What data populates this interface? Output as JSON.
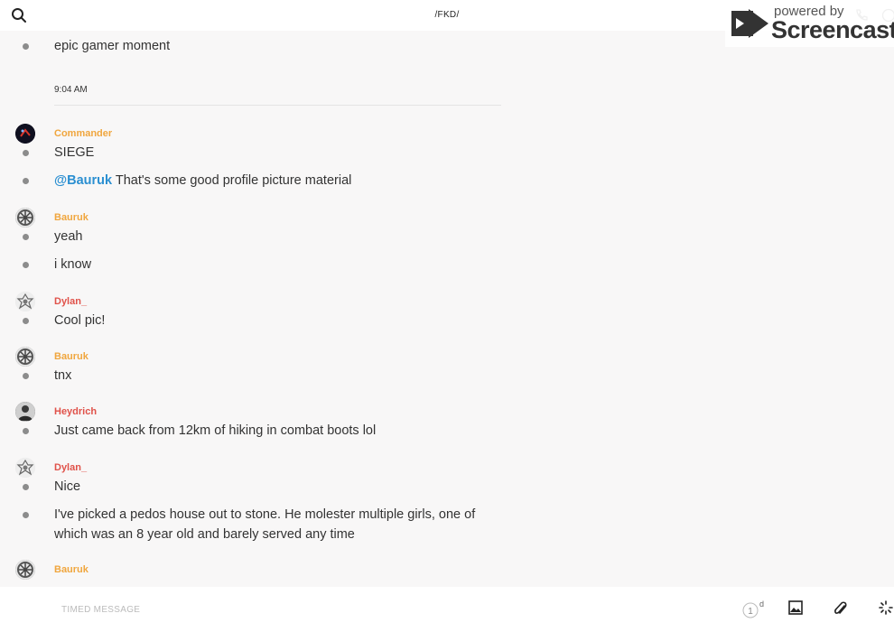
{
  "header": {
    "title": "/FKD/",
    "search_icon": "search-icon",
    "call_icon": "phone-icon",
    "info_icon": "info-icon"
  },
  "watermark": {
    "powered": "powered by",
    "brand": "Screencastify"
  },
  "messages": {
    "m0": "epic gamer moment",
    "timestamp": "9:04 AM",
    "g1_user": "Commander",
    "m1": "SIEGE",
    "m2_mention": "@Bauruk",
    "m2_text": " That's some good profile picture material",
    "g2_user": "Bauruk",
    "m3": "yeah",
    "m4": "i know",
    "g3_user": "Dylan_",
    "m5": "Cool pic!",
    "g4_user": "Bauruk",
    "m6": "tnx",
    "g5_user": "Heydrich",
    "m7": "Just came back from 12km of hiking in combat boots lol",
    "g6_user": "Dylan_",
    "m8": "Nice",
    "m9": "I've picked a pedos house out to stone. He molester multiple girls, one of which was an 8 year old and barely served any time",
    "g7_user": "Bauruk"
  },
  "composer": {
    "placeholder": "TIMED MESSAGE",
    "timer_value": "1",
    "timer_unit": "d",
    "image_icon": "image-icon",
    "attach_icon": "paperclip-icon",
    "loading_icon": "spinner-icon"
  },
  "colors": {
    "orange_name": "#f0a63e",
    "red_name": "#e0524a",
    "mention": "#2b8fd1"
  }
}
